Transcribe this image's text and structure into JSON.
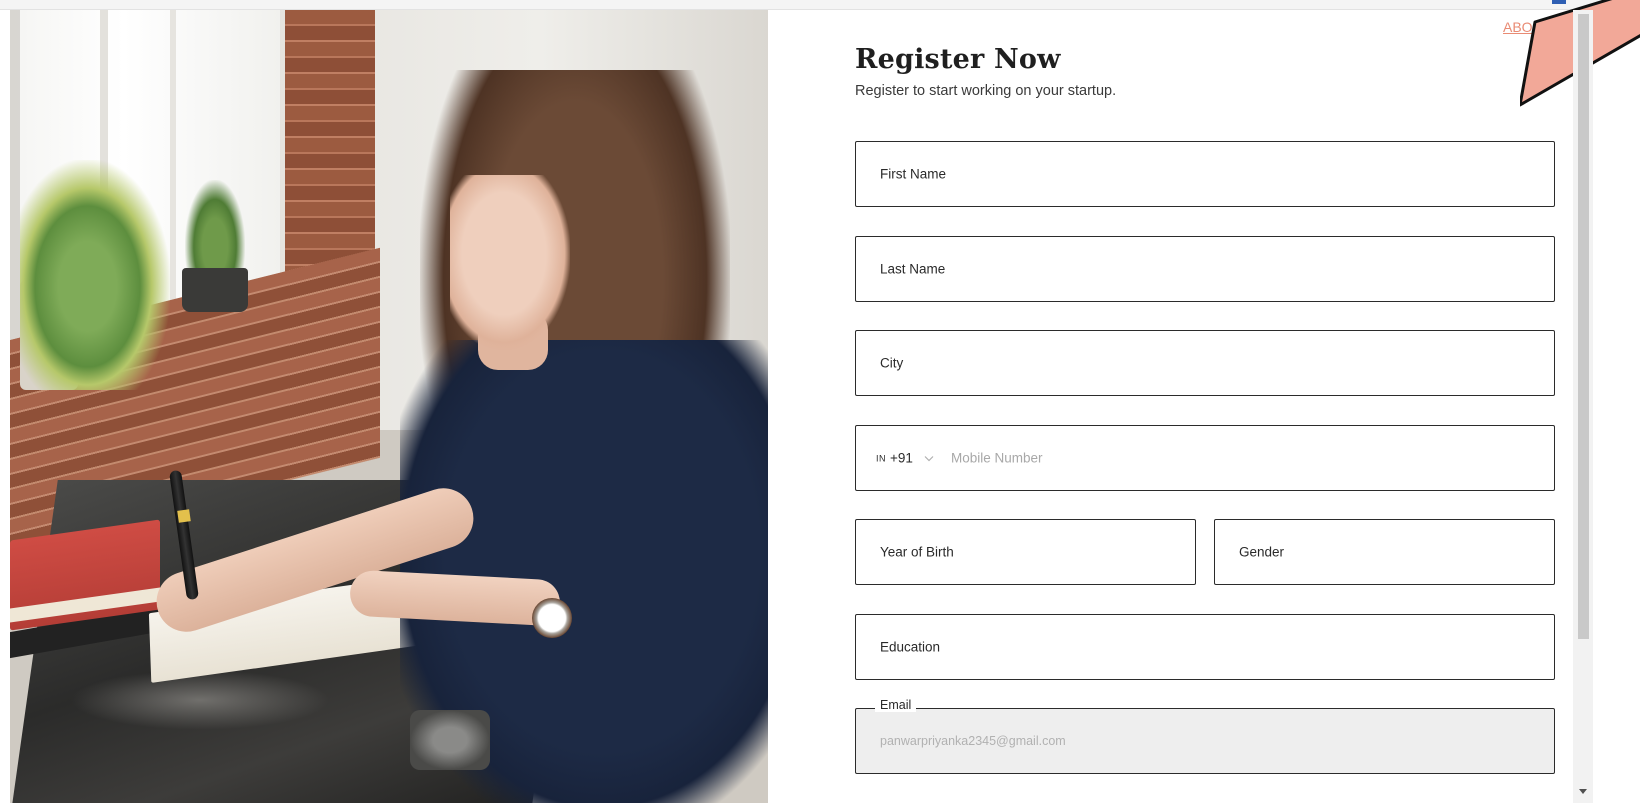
{
  "header": {
    "about_link": "ABO"
  },
  "form": {
    "title": "Register Now",
    "subtitle": "Register to start working on your startup.",
    "fields": {
      "first_name": {
        "label": "First Name"
      },
      "last_name": {
        "label": "Last Name"
      },
      "city": {
        "label": "City"
      },
      "mobile": {
        "country_code": "IN",
        "dial_code": "+91",
        "placeholder": "Mobile Number"
      },
      "year_of_birth": {
        "label": "Year of Birth"
      },
      "gender": {
        "label": "Gender"
      },
      "education": {
        "label": "Education"
      },
      "email": {
        "label": "Email",
        "value": "panwarpriyanka2345@gmail.com"
      }
    }
  },
  "icons": {
    "phone_dropdown": "chevron-down-icon",
    "scroll_down": "triangle-down-icon",
    "pointer": "pointer-arrow-icon"
  },
  "colors": {
    "accent": "#e98b74",
    "pointer_fill": "#f2a898",
    "field_border": "#2b2b2b",
    "disabled_field_bg": "#eeeeee"
  }
}
